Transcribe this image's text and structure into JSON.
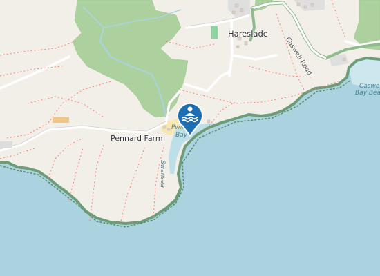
{
  "map": {
    "labels": {
      "hareslade": "Hareslade",
      "pennard_farm": "Pennard Farm",
      "caswell_road": "Caswell Road",
      "caswell_bay": "Caswell",
      "caswell_bay_2": "Bay Bea",
      "pwll_bay_1": "Pwll",
      "pwll_bay_2": "Bay",
      "swansea": "Swansea"
    },
    "marker": {
      "icon": "swimming-icon",
      "color": "#1e6eb4"
    },
    "colors": {
      "land": "#f2efe9",
      "sea": "#aad3df",
      "woodland": "#add19e",
      "path": "#fa8072",
      "marker": "#1e6eb4"
    }
  }
}
